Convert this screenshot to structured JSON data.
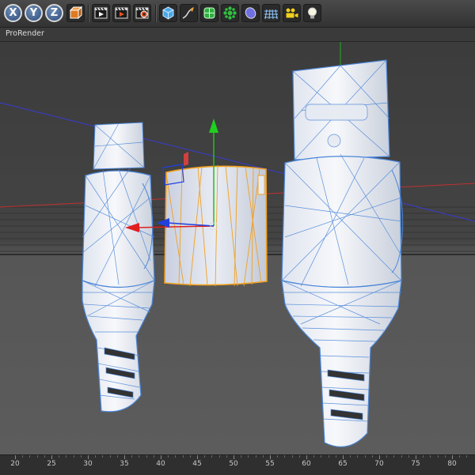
{
  "toolbar": {
    "axis_buttons": [
      "X",
      "Y",
      "Z"
    ],
    "icons": [
      "coordinate-system-icon",
      "render-view-icon",
      "render-picture-viewer-icon",
      "render-settings-icon",
      "cube-primitive-icon",
      "spline-pen-icon",
      "subdivision-generator-icon",
      "cloner-mograph-icon",
      "deformer-icon",
      "floor-environment-icon",
      "camera-icon",
      "light-icon"
    ]
  },
  "viewport": {
    "view_label": "ProRender"
  },
  "timeline": {
    "ruler_labels": [
      "20",
      "25",
      "30",
      "35",
      "40",
      "45",
      "50",
      "55",
      "60",
      "65",
      "70",
      "75",
      "80"
    ]
  },
  "colors": {
    "selection_outline": "#f0a020",
    "mesh_wire": "#4b86d8",
    "mesh_fill": "#eef1f6",
    "x_axis": "#e02020",
    "y_axis": "#20c020",
    "z_axis": "#2040e0"
  }
}
